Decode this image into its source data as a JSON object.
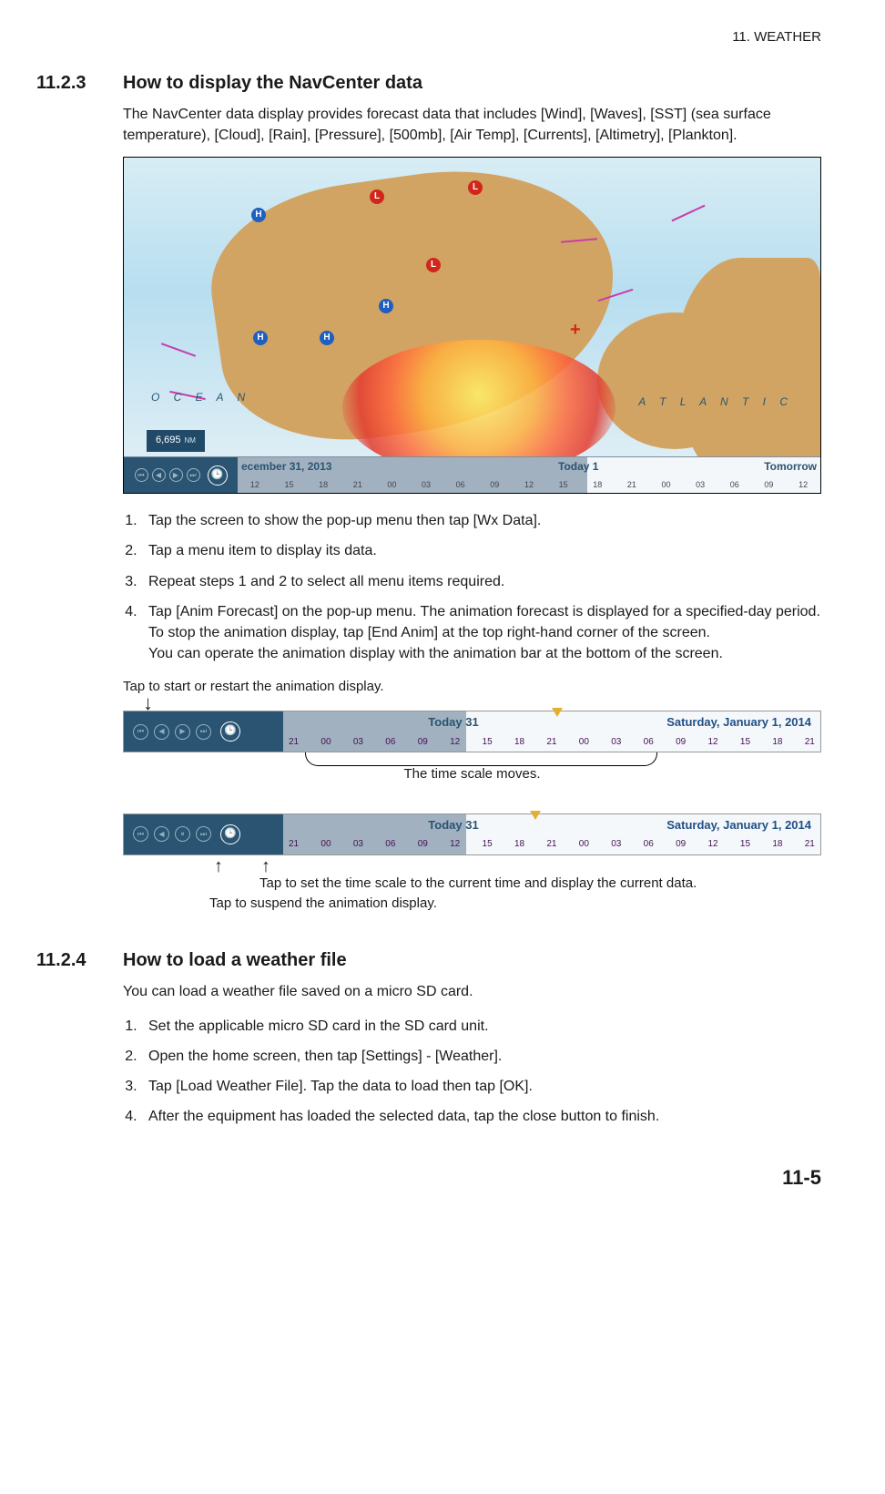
{
  "header": {
    "chapter": "11.  WEATHER"
  },
  "section1": {
    "num": "11.2.3",
    "title": "How to display the NavCenter data",
    "intro": "The NavCenter data display provides forecast data that includes [Wind], [Waves], [SST] (sea surface temperature), [Cloud], [Rain], [Pressure], [500mb], [Air Temp], [Currents], [Altimetry], [Plankton].",
    "steps": [
      "Tap the screen to show the pop-up menu then tap [Wx Data].",
      "Tap a menu item to display its data.",
      "Repeat steps 1 and 2 to select all menu items required.",
      "Tap [Anim Forecast] on the pop-up menu. The animation forecast is displayed for a specified-day period. To stop the animation display, tap [End Anim] at the top right-hand corner of the screen.\nYou can operate the animation display with the animation bar at the bottom of the screen."
    ]
  },
  "map": {
    "scale_value": "6,695",
    "scale_unit": "NM",
    "ocean_left": "O  C  E  A  N",
    "ocean_right": "A  T  L  A  N  T  I  C",
    "timebar": {
      "left_date": "ecember 31, 2013",
      "center": "Today 1",
      "right": "Tomorrow",
      "ticks": [
        "12",
        "15",
        "18",
        "21",
        "00",
        "03",
        "06",
        "09",
        "12",
        "15",
        "18",
        "21",
        "00",
        "03",
        "06",
        "09",
        "12"
      ]
    }
  },
  "anim": {
    "label_start": "Tap to start or restart the animation display.",
    "brace_text": "The time scale moves.",
    "label_clock": "Tap to set the time scale to the current time and display the current data.",
    "label_pause": "Tap to suspend the animation display.",
    "bar": {
      "today": "Today 31",
      "saturday": "Saturday, January 1, 2014",
      "ticks": [
        "21",
        "00",
        "03",
        "06",
        "09",
        "12",
        "15",
        "18",
        "21",
        "00",
        "03",
        "06",
        "09",
        "12",
        "15",
        "18",
        "21"
      ]
    }
  },
  "section2": {
    "num": "11.2.4",
    "title": "How to load a weather file",
    "intro": "You can load a weather file saved on a micro SD card.",
    "steps": [
      "Set the applicable micro SD card in the SD card unit.",
      "Open the home screen, then tap [Settings] - [Weather].",
      "Tap [Load Weather File]. Tap the data to load then tap [OK].",
      "After the equipment has loaded the selected data, tap the close button to finish."
    ]
  },
  "footer": {
    "page": "11-5"
  }
}
